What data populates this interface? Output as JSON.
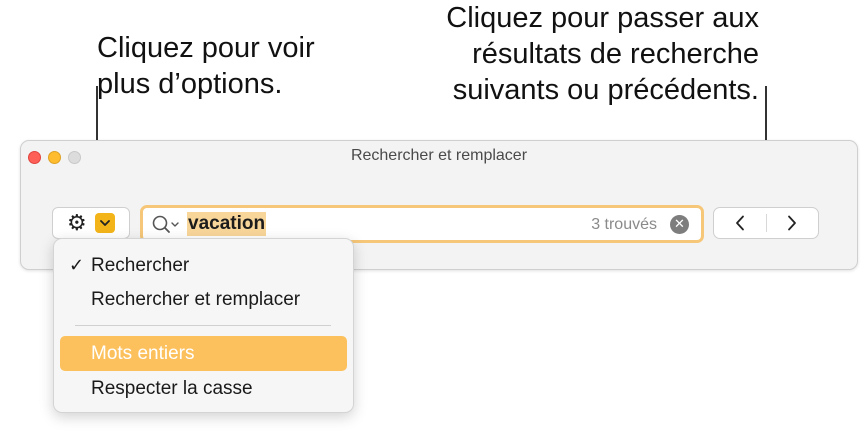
{
  "callouts": {
    "options_line1": "Cliquez pour voir",
    "options_line2": "plus d’options.",
    "nav_line1": "Cliquez pour passer aux",
    "nav_line2": "résultats de recherche",
    "nav_line3": "suivants ou précédents."
  },
  "window": {
    "title": "Rechercher et remplacer"
  },
  "toolbar": {
    "gear_icon": "gear-icon",
    "options_chevron_icon": "chevron-down-icon"
  },
  "search": {
    "value": "vacation",
    "result_count": "3 trouvés",
    "clear_symbol": "✕"
  },
  "nav": {
    "prev_icon": "chevron-left-icon",
    "next_icon": "chevron-right-icon"
  },
  "menu": {
    "items": [
      {
        "label": "Rechercher",
        "checked": true
      },
      {
        "label": "Rechercher et remplacer",
        "checked": false
      },
      {
        "label": "Mots entiers",
        "highlighted": true
      },
      {
        "label": "Respecter la casse",
        "checked": false
      }
    ],
    "check_symbol": "✓"
  },
  "colors": {
    "accent_yellow": "#f2b419",
    "highlight": "#fcc15d",
    "search_focus_ring": "#f6c779",
    "match_highlight": "#f8d69a"
  }
}
